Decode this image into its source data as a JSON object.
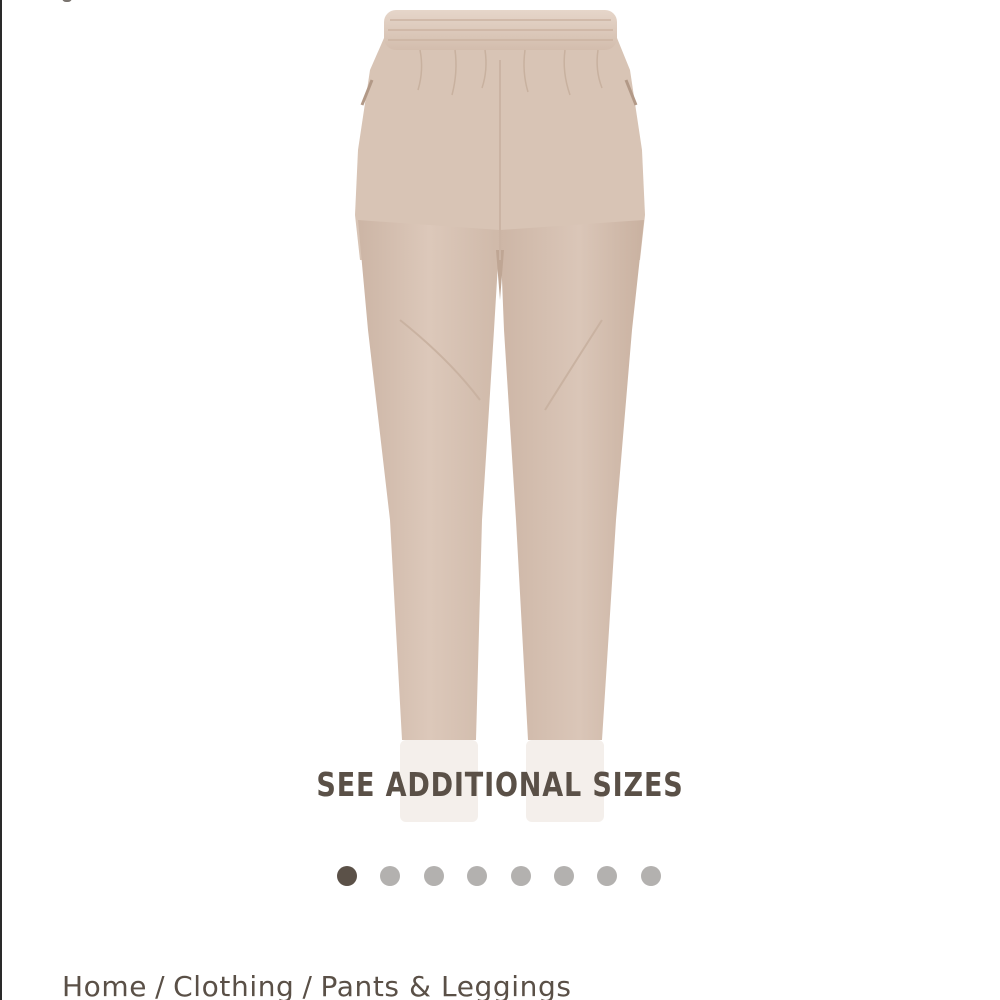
{
  "product": {
    "image_alt": "Beige velour jogger pants",
    "colors": {
      "fabric": "#d7c2b3",
      "fabric_shadow": "#c8b09f",
      "waistband": "#dcc8b9",
      "text": "#5a5047",
      "dot_active": "#5b5148",
      "dot_inactive": "#b3b1af"
    }
  },
  "overlay": {
    "see_sizes_label": "SEE ADDITIONAL SIZES"
  },
  "carousel": {
    "total": 8,
    "active_index": 0
  },
  "breadcrumb": {
    "items": [
      "Home",
      "Clothing",
      "Pants & Leggings"
    ],
    "separator": "/"
  }
}
